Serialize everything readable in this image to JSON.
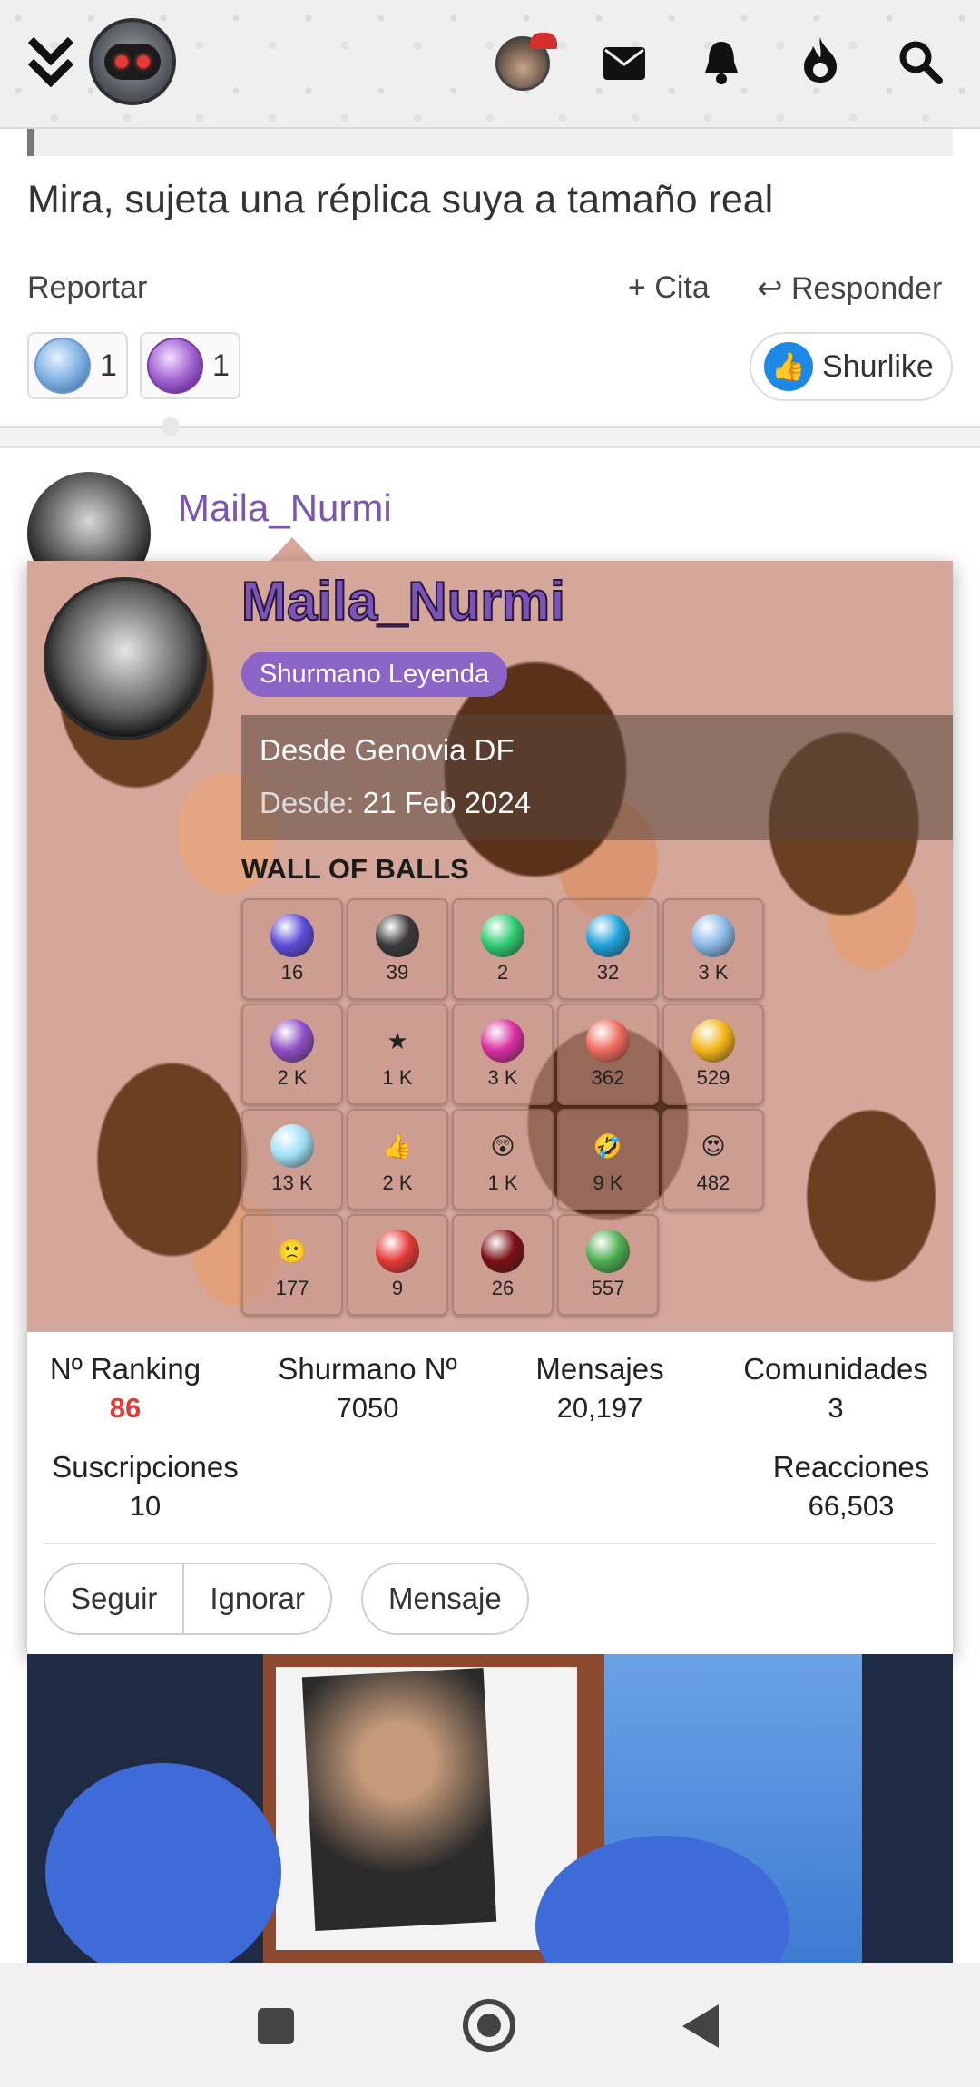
{
  "header": {
    "menu_icon": "double-chevron-down-icon",
    "logo": "robot-logo",
    "icons": [
      "avatar",
      "mail-icon",
      "bell-icon",
      "fire-icon",
      "search-icon"
    ]
  },
  "post": {
    "text": "Mira, sujeta una réplica suya a tamaño real",
    "report_label": "Reportar",
    "cite_label": "+ Cita",
    "reply_label": "Responder",
    "reactions": [
      {
        "gem": "blue",
        "count": "1"
      },
      {
        "gem": "purple",
        "count": "1"
      }
    ],
    "shurlike_label": "Shurlike"
  },
  "post2": {
    "username": "Maila_Nurmi"
  },
  "profile_card": {
    "username": "Maila_Nurmi",
    "rank_badge": "Shurmano Leyenda",
    "location": "Desde Genovia DF",
    "since_label": "Desde:",
    "since_date": "21 Feb 2024",
    "wall_title": "WALL OF BALLS",
    "wall_items": [
      {
        "icon": "swirl-ball",
        "color": "#5c4bd8",
        "glyph": "",
        "count": "16"
      },
      {
        "icon": "santa-robot-ball",
        "color": "#3a3a3a",
        "glyph": "",
        "count": "39"
      },
      {
        "icon": "green-gem",
        "color": "#2ecc71",
        "glyph": "",
        "count": "2"
      },
      {
        "icon": "cyan-gem",
        "color": "#1ea2d9",
        "glyph": "",
        "count": "32"
      },
      {
        "icon": "light-blue-gem",
        "color": "#8ab8e6",
        "glyph": "",
        "count": "3 K"
      },
      {
        "icon": "purple-gem",
        "color": "#8d4fc4",
        "glyph": "",
        "count": "2 K"
      },
      {
        "icon": "orange-dragon-ball",
        "color": "#f37a1f",
        "glyph": "★",
        "count": "1 K"
      },
      {
        "icon": "magenta-gem",
        "color": "#d92ea0",
        "glyph": "",
        "count": "3 K"
      },
      {
        "icon": "salmon-gem",
        "color": "#ef6a5c",
        "glyph": "",
        "count": "362"
      },
      {
        "icon": "gold-gem",
        "color": "#f3b417",
        "glyph": "",
        "count": "529"
      },
      {
        "icon": "diamond-gem",
        "color": "#9fe0f5",
        "glyph": "",
        "count": "13 K"
      },
      {
        "icon": "like-icon",
        "color": "#1e88e5",
        "glyph": "👍",
        "count": "2 K"
      },
      {
        "icon": "shocked-emoji",
        "color": "#f7c400",
        "glyph": "😲",
        "count": "1 K"
      },
      {
        "icon": "laughing-emoji",
        "color": "#f7c400",
        "glyph": "🤣",
        "count": "9 K"
      },
      {
        "icon": "heart-eyes-emoji",
        "color": "#f7c400",
        "glyph": "😍",
        "count": "482"
      },
      {
        "icon": "sad-emoji",
        "color": "#f7c400",
        "glyph": "🙁",
        "count": "177"
      },
      {
        "icon": "red-gem",
        "color": "#e53935",
        "glyph": "",
        "count": "9"
      },
      {
        "icon": "dark-red-gem",
        "color": "#7a0f12",
        "glyph": "",
        "count": "26"
      },
      {
        "icon": "grinch-santa",
        "color": "#4caf50",
        "glyph": "",
        "count": "557"
      }
    ],
    "stats": {
      "ranking_label": "Nº Ranking",
      "ranking_value": "86",
      "shurmano_label": "Shurmano Nº",
      "shurmano_value": "7050",
      "messages_label": "Mensajes",
      "messages_value": "20,197",
      "communities_label": "Comunidades",
      "communities_value": "3",
      "subscriptions_label": "Suscripciones",
      "subscriptions_value": "10",
      "reactions_label": "Reacciones",
      "reactions_value": "66,503"
    },
    "buttons": {
      "follow": "Seguir",
      "ignore": "Ignorar",
      "message": "Mensaje"
    }
  },
  "nav": {
    "recents": "square-icon",
    "home": "circle-icon",
    "back": "triangle-back-icon"
  }
}
